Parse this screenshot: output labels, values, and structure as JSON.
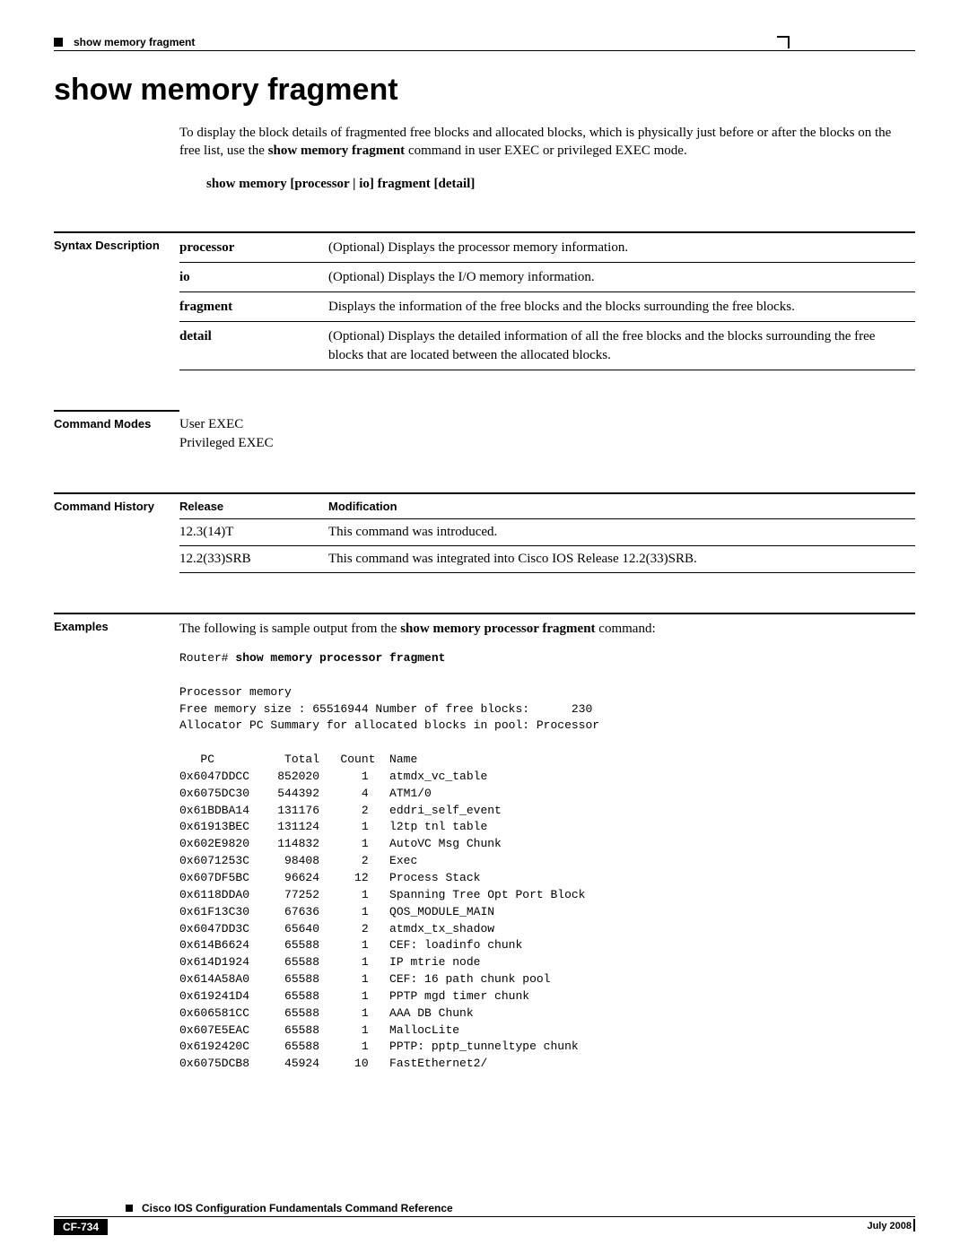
{
  "header": {
    "running_title": "show memory fragment"
  },
  "title": "show memory fragment",
  "intro": {
    "text_before_bold": "To display the block details of fragmented free blocks and allocated blocks, which is physically just before or after the blocks on the free list, use the ",
    "bold_cmd": "show memory fragment",
    "text_after_bold": " command in user EXEC or privileged EXEC mode."
  },
  "syntax_line": "show memory [processor | io] fragment [detail]",
  "syntax_desc": {
    "label": "Syntax Description",
    "rows": [
      {
        "keyword": "processor",
        "desc": "(Optional) Displays the processor memory information."
      },
      {
        "keyword": "io",
        "desc": "(Optional) Displays the I/O memory information."
      },
      {
        "keyword": "fragment",
        "desc": "Displays the information of the free blocks and the blocks surrounding the free blocks."
      },
      {
        "keyword": "detail",
        "desc": "(Optional) Displays the detailed information of all the free blocks and the blocks surrounding the free blocks that are located between the allocated blocks."
      }
    ]
  },
  "command_modes": {
    "label": "Command Modes",
    "line1": "User EXEC",
    "line2": "Privileged EXEC"
  },
  "command_history": {
    "label": "Command History",
    "head_release": "Release",
    "head_mod": "Modification",
    "rows": [
      {
        "release": "12.3(14)T",
        "mod": "This command was introduced."
      },
      {
        "release": "12.2(33)SRB",
        "mod": "This command was integrated into Cisco IOS Release 12.2(33)SRB."
      }
    ]
  },
  "examples": {
    "label": "Examples",
    "lead_before": "The following is sample output from the ",
    "lead_bold": "show memory processor fragment",
    "lead_after": " command:",
    "cli_prompt": "Router# ",
    "cli_cmd": "show memory processor fragment",
    "cli_body": "Processor memory\nFree memory size : 65516944 Number of free blocks:      230\nAllocator PC Summary for allocated blocks in pool: Processor\n\n   PC          Total   Count  Name\n0x6047DDCC    852020      1   atmdx_vc_table\n0x6075DC30    544392      4   ATM1/0\n0x61BDBA14    131176      2   eddri_self_event\n0x61913BEC    131124      1   l2tp tnl table\n0x602E9820    114832      1   AutoVC Msg Chunk\n0x6071253C     98408      2   Exec\n0x607DF5BC     96624     12   Process Stack\n0x6118DDA0     77252      1   Spanning Tree Opt Port Block\n0x61F13C30     67636      1   QOS_MODULE_MAIN\n0x6047DD3C     65640      2   atmdx_tx_shadow\n0x614B6624     65588      1   CEF: loadinfo chunk\n0x614D1924     65588      1   IP mtrie node\n0x614A58A0     65588      1   CEF: 16 path chunk pool\n0x619241D4     65588      1   PPTP mgd timer chunk\n0x606581CC     65588      1   AAA DB Chunk\n0x607E5EAC     65588      1   MallocLite\n0x6192420C     65588      1   PPTP: pptp_tunneltype chunk\n0x6075DCB8     45924     10   FastEthernet2/"
  },
  "footer": {
    "doc_title": "Cisco IOS Configuration Fundamentals Command Reference",
    "page_number": "CF-734",
    "date": "July 2008"
  }
}
